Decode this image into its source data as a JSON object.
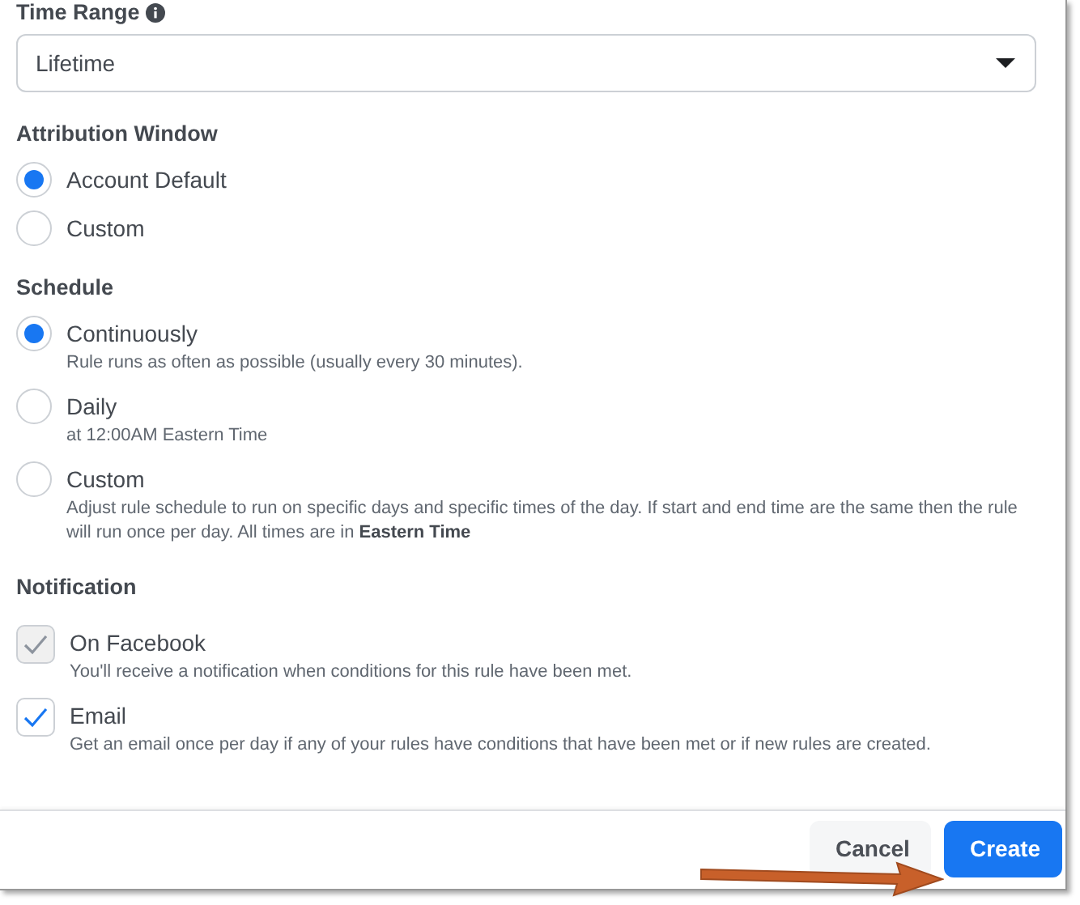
{
  "time_range": {
    "label": "Time Range",
    "value": "Lifetime"
  },
  "attribution_window": {
    "label": "Attribution Window",
    "options": [
      {
        "label": "Account Default",
        "selected": true
      },
      {
        "label": "Custom",
        "selected": false
      }
    ]
  },
  "schedule": {
    "label": "Schedule",
    "options": [
      {
        "label": "Continuously",
        "description": "Rule runs as often as possible (usually every 30 minutes).",
        "selected": true
      },
      {
        "label": "Daily",
        "description": "at 12:00AM Eastern Time",
        "selected": false
      },
      {
        "label": "Custom",
        "description": "Adjust rule schedule to run on specific days and specific times of the day. If start and end time are the same then the rule will run once per day. All times are in **Eastern Time**",
        "selected": false
      }
    ]
  },
  "notification": {
    "label": "Notification",
    "options": [
      {
        "label": "On Facebook",
        "description": "You'll receive a notification when conditions for this rule have been met.",
        "checked": true,
        "disabled": true
      },
      {
        "label": "Email",
        "description": "Get an email once per day if any of your rules have conditions that have been met or if new rules are created.",
        "checked": true,
        "disabled": false
      }
    ]
  },
  "buttons": [
    {
      "label": "Cancel",
      "kind": "secondary"
    },
    {
      "label": "Create",
      "kind": "primary"
    }
  ],
  "annotation": {
    "kind": "arrow"
  }
}
